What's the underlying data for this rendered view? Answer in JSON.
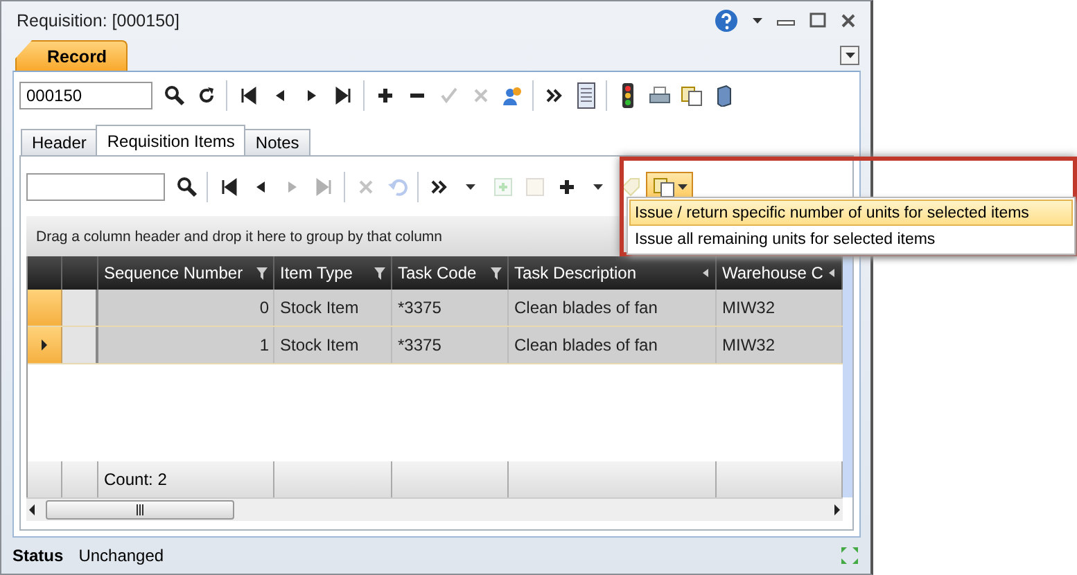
{
  "window": {
    "title": "Requisition: [000150]"
  },
  "ribbon_tabs": [
    {
      "label": "Record",
      "selected": true
    }
  ],
  "record_field": {
    "value": "000150"
  },
  "main_toolbar": [
    {
      "kind": "search",
      "disabled": false
    },
    {
      "kind": "refresh",
      "disabled": false
    },
    {
      "kind": "sep"
    },
    {
      "kind": "first",
      "disabled": false
    },
    {
      "kind": "prev",
      "disabled": false
    },
    {
      "kind": "next",
      "disabled": false
    },
    {
      "kind": "last",
      "disabled": false
    },
    {
      "kind": "sep"
    },
    {
      "kind": "add",
      "disabled": false
    },
    {
      "kind": "remove",
      "disabled": false
    },
    {
      "kind": "accept",
      "disabled": true
    },
    {
      "kind": "cancel",
      "disabled": true
    },
    {
      "kind": "users",
      "disabled": false
    },
    {
      "kind": "sep"
    },
    {
      "kind": "more",
      "disabled": false
    },
    {
      "kind": "list",
      "disabled": false
    },
    {
      "kind": "sep"
    },
    {
      "kind": "traffic",
      "disabled": false
    },
    {
      "kind": "print",
      "disabled": false
    },
    {
      "kind": "copy",
      "disabled": false
    },
    {
      "kind": "server",
      "disabled": false
    }
  ],
  "tabs": [
    {
      "label": "Header",
      "selected": false
    },
    {
      "label": "Requisition Items",
      "selected": true
    },
    {
      "label": "Notes",
      "selected": false
    }
  ],
  "grid_toolbar": [
    {
      "kind": "search",
      "disabled": false
    },
    {
      "kind": "sep"
    },
    {
      "kind": "first",
      "disabled": false
    },
    {
      "kind": "prev",
      "disabled": false
    },
    {
      "kind": "next",
      "disabled": true
    },
    {
      "kind": "last",
      "disabled": true
    },
    {
      "kind": "sep"
    },
    {
      "kind": "cancel",
      "disabled": true
    },
    {
      "kind": "undo",
      "disabled": true
    },
    {
      "kind": "sep"
    },
    {
      "kind": "more",
      "disabled": false
    },
    {
      "kind": "caret",
      "disabled": false
    },
    {
      "kind": "newrow",
      "disabled": true
    },
    {
      "kind": "copyrow",
      "disabled": true
    },
    {
      "kind": "add",
      "disabled": false
    },
    {
      "kind": "caret",
      "disabled": false
    },
    {
      "kind": "tag",
      "disabled": true
    },
    {
      "kind": "issue",
      "disabled": false,
      "pressed": true
    }
  ],
  "group_panel": {
    "text": "Drag a column header and drop it here to group by that column"
  },
  "table": {
    "columns": [
      {
        "label": "Sequence Number",
        "filter": true
      },
      {
        "label": "Item Type",
        "filter": true
      },
      {
        "label": "Task Code",
        "filter": true
      },
      {
        "label": "Task Description",
        "filter": false
      },
      {
        "label": "Warehouse C",
        "filter": false
      }
    ],
    "rows": [
      {
        "cells": [
          "0",
          "Stock Item",
          "*3375",
          "Clean blades of fan",
          "MIW32"
        ],
        "selected": true,
        "current": false
      },
      {
        "cells": [
          "1",
          "Stock Item",
          "*3375",
          "Clean blades of fan",
          "MIW32"
        ],
        "selected": true,
        "current": true
      }
    ],
    "footer": "Count: 2"
  },
  "status_bar": {
    "label": "Status",
    "value": "Unchanged"
  },
  "issue_menu": {
    "items": [
      {
        "label": "Issue / return specific number of units for selected items",
        "selected": true
      },
      {
        "label": "Issue all remaining units for selected items",
        "selected": false
      }
    ]
  }
}
